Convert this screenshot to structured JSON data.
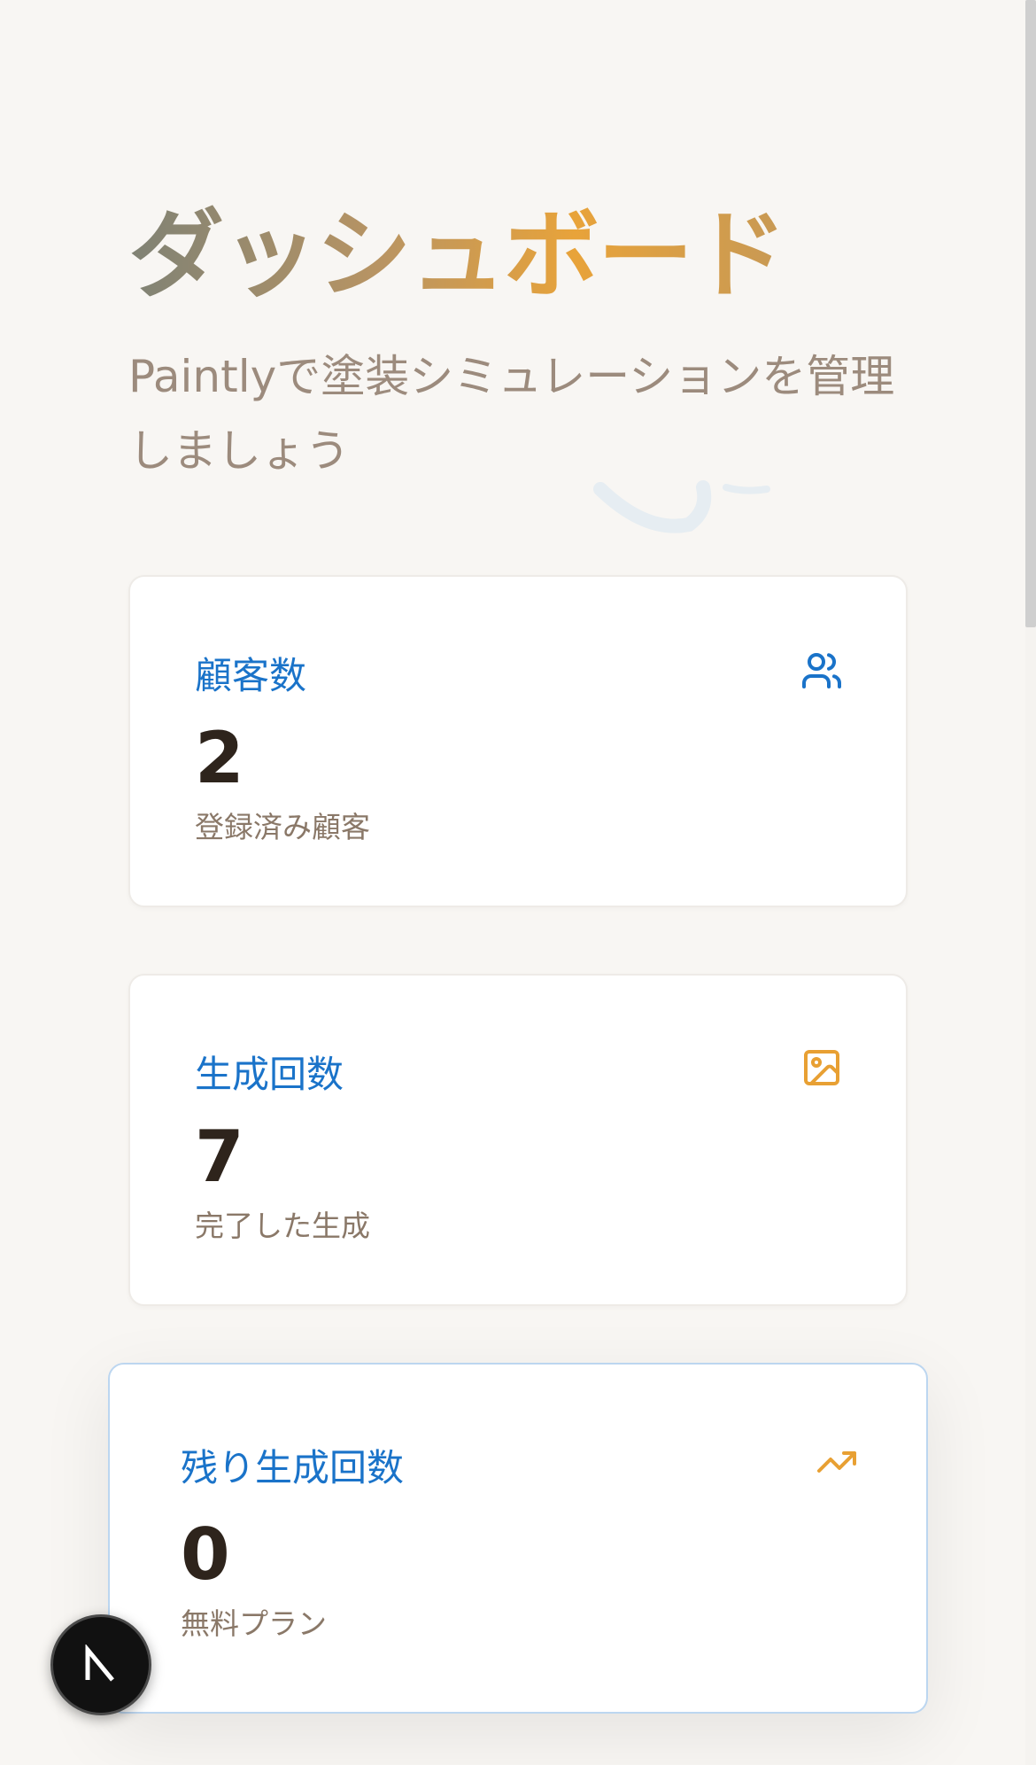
{
  "header": {
    "title": "ダッシュボード",
    "subtitle": "Paintlyで塗装シミュレーションを管理しましょう"
  },
  "stats": [
    {
      "title": "顧客数",
      "value": "2",
      "caption": "登録済み顧客",
      "icon": "users-icon",
      "icon_color": "#1a73c9"
    },
    {
      "title": "生成回数",
      "value": "7",
      "caption": "完了した生成",
      "icon": "image-icon",
      "icon_color": "#e8a033"
    },
    {
      "title": "残り生成回数",
      "value": "0",
      "caption": "無料プラン",
      "icon": "trending-up-icon",
      "icon_color": "#e8a033"
    }
  ],
  "colors": {
    "background": "#f8f6f3",
    "accent_blue": "#1a73c9",
    "accent_orange": "#e8a033",
    "value_text": "#2e241c"
  },
  "dev_badge": {
    "icon": "nextjs-n-icon"
  }
}
